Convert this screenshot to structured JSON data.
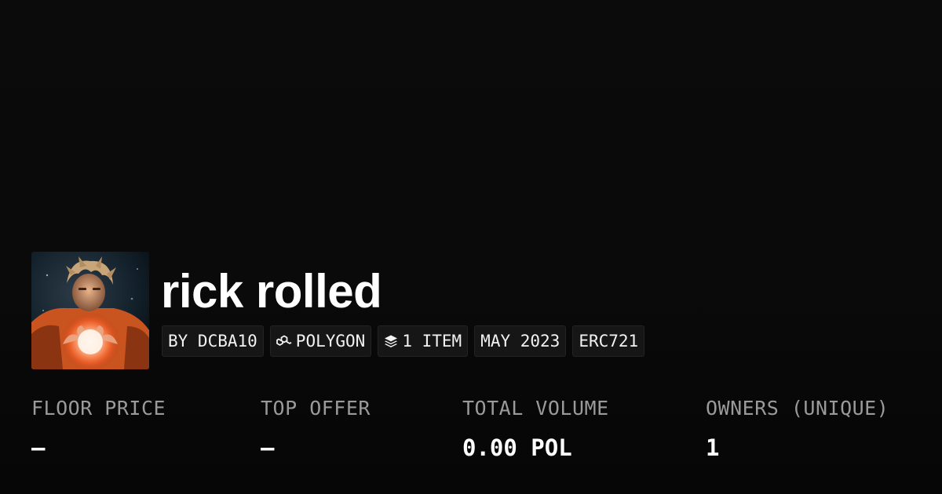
{
  "collection": {
    "name": "rick rolled",
    "image_alt": "rick rolled collection image"
  },
  "chips": [
    {
      "label": "BY DCBA10",
      "icon": "none"
    },
    {
      "label": "POLYGON",
      "icon": "polygon-chain-icon"
    },
    {
      "label": "1 ITEM",
      "icon": "layers-icon"
    },
    {
      "label": "MAY 2023",
      "icon": "none"
    },
    {
      "label": "ERC721",
      "icon": "none"
    }
  ],
  "stats": [
    {
      "label": "FLOOR PRICE",
      "value": "–"
    },
    {
      "label": "TOP OFFER",
      "value": "–"
    },
    {
      "label": "TOTAL VOLUME",
      "value": "0.00 POL"
    },
    {
      "label": "OWNERS (UNIQUE)",
      "value": "1"
    }
  ],
  "colors": {
    "background": "#0a0a0a",
    "chip_background": "#161616",
    "label_text": "#9a9a9a",
    "value_text": "#ffffff"
  }
}
